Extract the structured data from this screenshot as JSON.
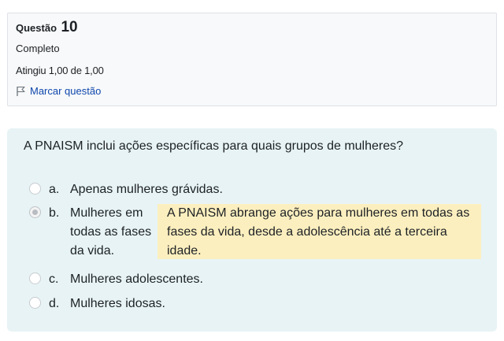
{
  "info": {
    "question_label": "Questão",
    "question_number": "10",
    "status": "Completo",
    "grade": "Atingiu 1,00 de 1,00",
    "flag_label": "Marcar questão"
  },
  "question": {
    "text": "A PNAISM inclui ações específicas para quais grupos de mulheres?",
    "options": [
      {
        "letter": "a.",
        "text": "Apenas mulheres grávidas.",
        "selected": false
      },
      {
        "letter": "b.",
        "text": "Mulheres em todas as fases da vida.",
        "selected": true
      },
      {
        "letter": "c.",
        "text": "Mulheres adolescentes.",
        "selected": false
      },
      {
        "letter": "d.",
        "text": "Mulheres idosas.",
        "selected": false
      }
    ],
    "feedback": "A PNAISM abrange ações para mulheres em todas as fases da vida, desde a adolescência até a terceira idade."
  },
  "colors": {
    "link": "#0f47ad",
    "feedback_bg": "#fcefbf",
    "formulation_bg": "#e7f3f5",
    "info_bg": "#f8f9fa"
  }
}
